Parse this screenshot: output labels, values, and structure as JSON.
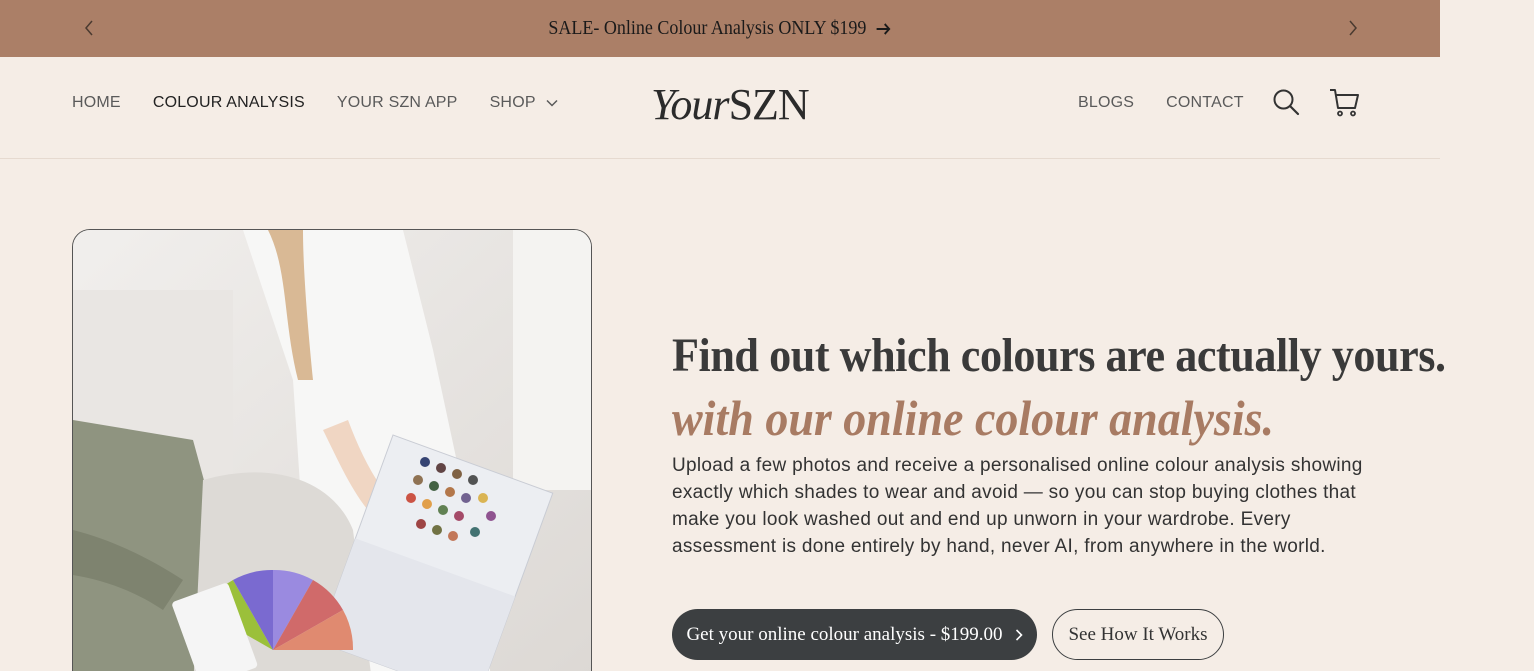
{
  "announcement": {
    "text": "SALE- Online Colour Analysis ONLY $199",
    "prev_icon": "chevron-left-icon",
    "next_icon": "chevron-right-icon"
  },
  "header": {
    "nav_left": [
      {
        "label": "HOME"
      },
      {
        "label": "COLOUR ANALYSIS"
      },
      {
        "label": "YOUR SZN APP"
      },
      {
        "label": "SHOP"
      }
    ],
    "logo": {
      "part1": "Your",
      "part2": "SZN"
    },
    "nav_right": [
      {
        "label": "BLOGS"
      },
      {
        "label": "CONTACT"
      }
    ],
    "icons": [
      "search-icon",
      "cart-icon"
    ]
  },
  "hero": {
    "headline": "Find out which colours are actually yours.",
    "subheadline": "with our online colour analysis.",
    "body": "Upload a few photos and receive a personalised online colour analysis showing exactly which shades to wear and avoid — so you can stop buying clothes that make you look washed out and end up unworn in your wardrobe. Every assessment is done entirely by hand, never AI, from anywhere in the world.",
    "primary_cta": "Get your online colour analysis - $199.00",
    "secondary_cta": "See How It Works"
  },
  "colors": {
    "announcement_bg": "#ab7f67",
    "page_bg": "#f5ede6",
    "accent_text": "#a87b63",
    "button_dark": "#3c3f41"
  }
}
